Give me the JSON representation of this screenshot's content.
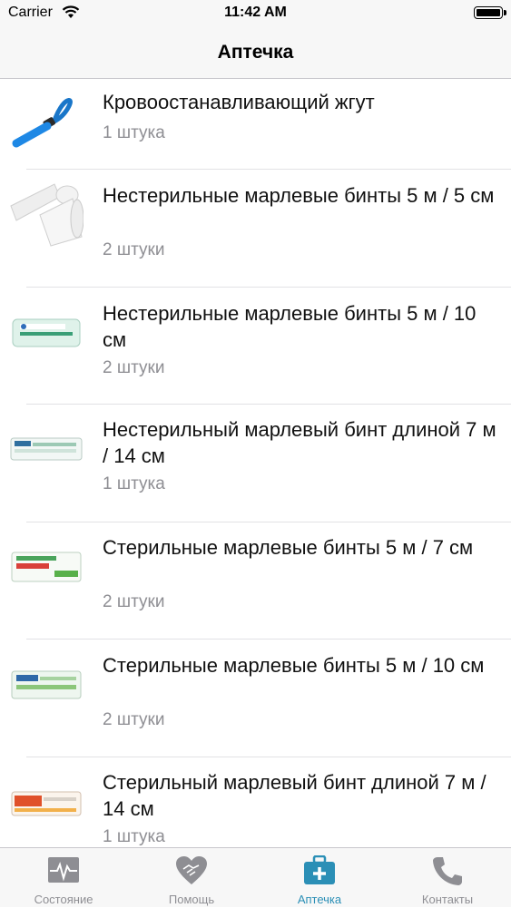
{
  "status_bar": {
    "carrier": "Carrier",
    "time": "11:42 AM"
  },
  "nav": {
    "title": "Аптечка"
  },
  "items": [
    {
      "title": "Кровоостанавливающий жгут",
      "qty": "1 штука",
      "image": "tourniquet"
    },
    {
      "title": "Нестерильные марлевые бинты 5 м / 5 см",
      "qty": "2 штуки",
      "image": "gauze-roll"
    },
    {
      "title": "Нестерильные марлевые бинты 5 м / 10 см",
      "qty": "2 штуки",
      "image": "bandage-pack-green"
    },
    {
      "title": "Нестерильный марлевый бинт длиной 7 м / 14 см",
      "qty": "1 штука",
      "image": "bandage-pack-blue"
    },
    {
      "title": "Стерильные марлевые бинты 5 м / 7 см",
      "qty": "2 штуки",
      "image": "bandage-pack-red-green"
    },
    {
      "title": "Стерильные марлевые бинты 5 м / 10 см",
      "qty": "2 штуки",
      "image": "bandage-pack-blue-green"
    },
    {
      "title": "Стерильный марлевый бинт длиной 7 м / 14 см",
      "qty": "1 штука",
      "image": "bandage-pack-orange"
    }
  ],
  "tabs": [
    {
      "label": "Состояние",
      "icon": "heart-monitor-icon",
      "active": false
    },
    {
      "label": "Помощь",
      "icon": "heart-handshake-icon",
      "active": false
    },
    {
      "label": "Аптечка",
      "icon": "first-aid-kit-icon",
      "active": true
    },
    {
      "label": "Контакты",
      "icon": "phone-icon",
      "active": false
    }
  ],
  "colors": {
    "active_tab": "#2b8fb6",
    "inactive_tab": "#8e8e93",
    "bar_bg": "#f7f7f7"
  }
}
